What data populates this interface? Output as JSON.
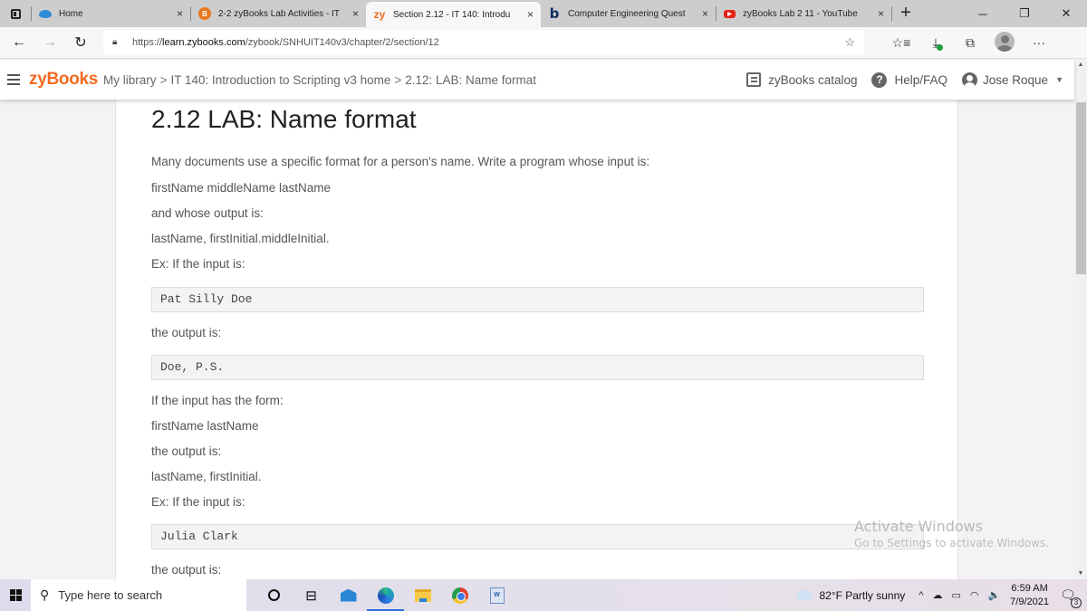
{
  "browser": {
    "tabs": [
      {
        "favicon": "cloud-icon",
        "title": "Home",
        "active": false
      },
      {
        "favicon": "brightspace-icon",
        "title": "2-2 zyBooks Lab Activities - IT",
        "active": false
      },
      {
        "favicon": "zybooks-icon",
        "favicon_text": "zy",
        "title": "Section 2.12 - IT 140: Introdu",
        "active": true
      },
      {
        "favicon": "bing-icon",
        "favicon_text": "b",
        "title": "Computer Engineering Quest",
        "active": false
      },
      {
        "favicon": "youtube-icon",
        "favicon_text": "▶",
        "title": "zyBooks Lab 2 11 - YouTube",
        "active": false
      }
    ],
    "close_glyph": "×",
    "new_tab_glyph": "+",
    "window_controls": {
      "minimize": "─",
      "restore": "❐",
      "close": "✕"
    },
    "nav": {
      "back": "←",
      "forward": "→",
      "refresh": "↻"
    },
    "url": {
      "scheme": "https://",
      "host": "learn.zybooks.com",
      "path": "/zybook/SNHUIT140v3/chapter/2/section/12"
    },
    "toolbar_glyphs": {
      "add_favorite": "☆",
      "favorites": "☆≡",
      "downloads": "⤓",
      "collections": "⧉",
      "more": "···"
    }
  },
  "zybooks_header": {
    "brand": "zyBooks",
    "breadcrumbs": [
      "My library",
      "IT 140: Introduction to Scripting v3 home",
      "2.12: LAB: Name format"
    ],
    "breadcrumb_sep": ">",
    "catalog_label": "zyBooks catalog",
    "help_label": "Help/FAQ",
    "help_glyph": "?",
    "user_name": "Jose Roque",
    "caret": "▼",
    "brand_color": "#f26b21"
  },
  "content": {
    "title": "2.12 LAB: Name format",
    "paragraphs": [
      "Many documents use a specific format for a person's name. Write a program whose input is:",
      "firstName middleName lastName",
      "and whose output is:",
      "lastName, firstInitial.middleInitial.",
      "Ex: If the input is:",
      "the output is:",
      "If the input has the form:",
      "firstName lastName",
      "the output is:",
      "lastName, firstInitial.",
      "Ex: If the input is:",
      "the output is:"
    ],
    "code_blocks": [
      "Pat Silly Doe",
      "Doe, P.S.",
      "Julia Clark"
    ]
  },
  "scrollbar": {
    "up": "▲",
    "down": "▼"
  },
  "watermark": {
    "line1": "Activate Windows",
    "line2": "Go to Settings to activate Windows."
  },
  "taskbar": {
    "search_placeholder": "Type here to search",
    "search_glyph": "⚲",
    "task_view_glyph": "⊟",
    "word_label": "W",
    "weather": "82°F  Partly sunny",
    "tray_glyphs": {
      "chevron": "^",
      "onedrive": "☁",
      "battery": "▭",
      "wifi": "◠",
      "volume": "🔈"
    },
    "time": "6:59 AM",
    "date": "7/9/2021",
    "notifications_glyph": "🗨",
    "notification_count": "3"
  }
}
